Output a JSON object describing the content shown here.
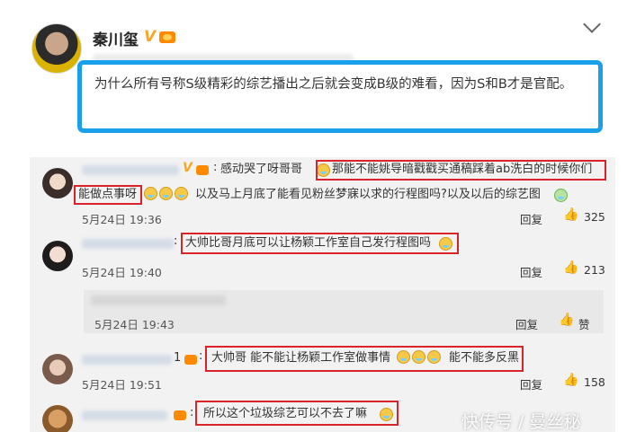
{
  "post": {
    "author": "秦川玺",
    "verified_mark": "V",
    "text": "为什么所有号称S级精彩的综艺播出之后就会变成B级的难看，因为S和B才是官配。"
  },
  "comments": [
    {
      "text_before": "感动哭了呀哥哥",
      "highlight_1": "那能不能姚导暗戳戳买通稿踩着ab洗白的时候你们",
      "highlight_2": "能做点事呀",
      "text_after": "以及马上月底了能看见粉丝梦寐以求的行程图吗?以及以后的综艺图",
      "date": "5月24日 19:36",
      "reply_label": "回复",
      "likes": "325"
    },
    {
      "highlight": "大帅比哥月底可以让杨颖工作室自己发行程图吗",
      "date": "5月24日 19:40",
      "reply_label": "回复",
      "likes": "213"
    },
    {
      "date": "5月24日 19:43",
      "reply_label": "回复",
      "likes": "赞"
    },
    {
      "name_suffix": "1",
      "highlight_a": "大帅哥 能不能让杨颖工作室做事情",
      "highlight_b": "能不能多反黑",
      "date": "5月24日 19:51",
      "reply_label": "回复",
      "likes": "158"
    },
    {
      "highlight": "所以这个垃圾综艺可以不去了嘛"
    }
  ],
  "icons": {
    "thumb": "thumbs-up-icon",
    "chevron": "chevron-down-icon"
  },
  "watermark": "快传号 / 曼丝秘",
  "colors": {
    "highlight_box": "#d9252a",
    "post_box": "#1aa0ea",
    "verify": "#f6a623"
  }
}
